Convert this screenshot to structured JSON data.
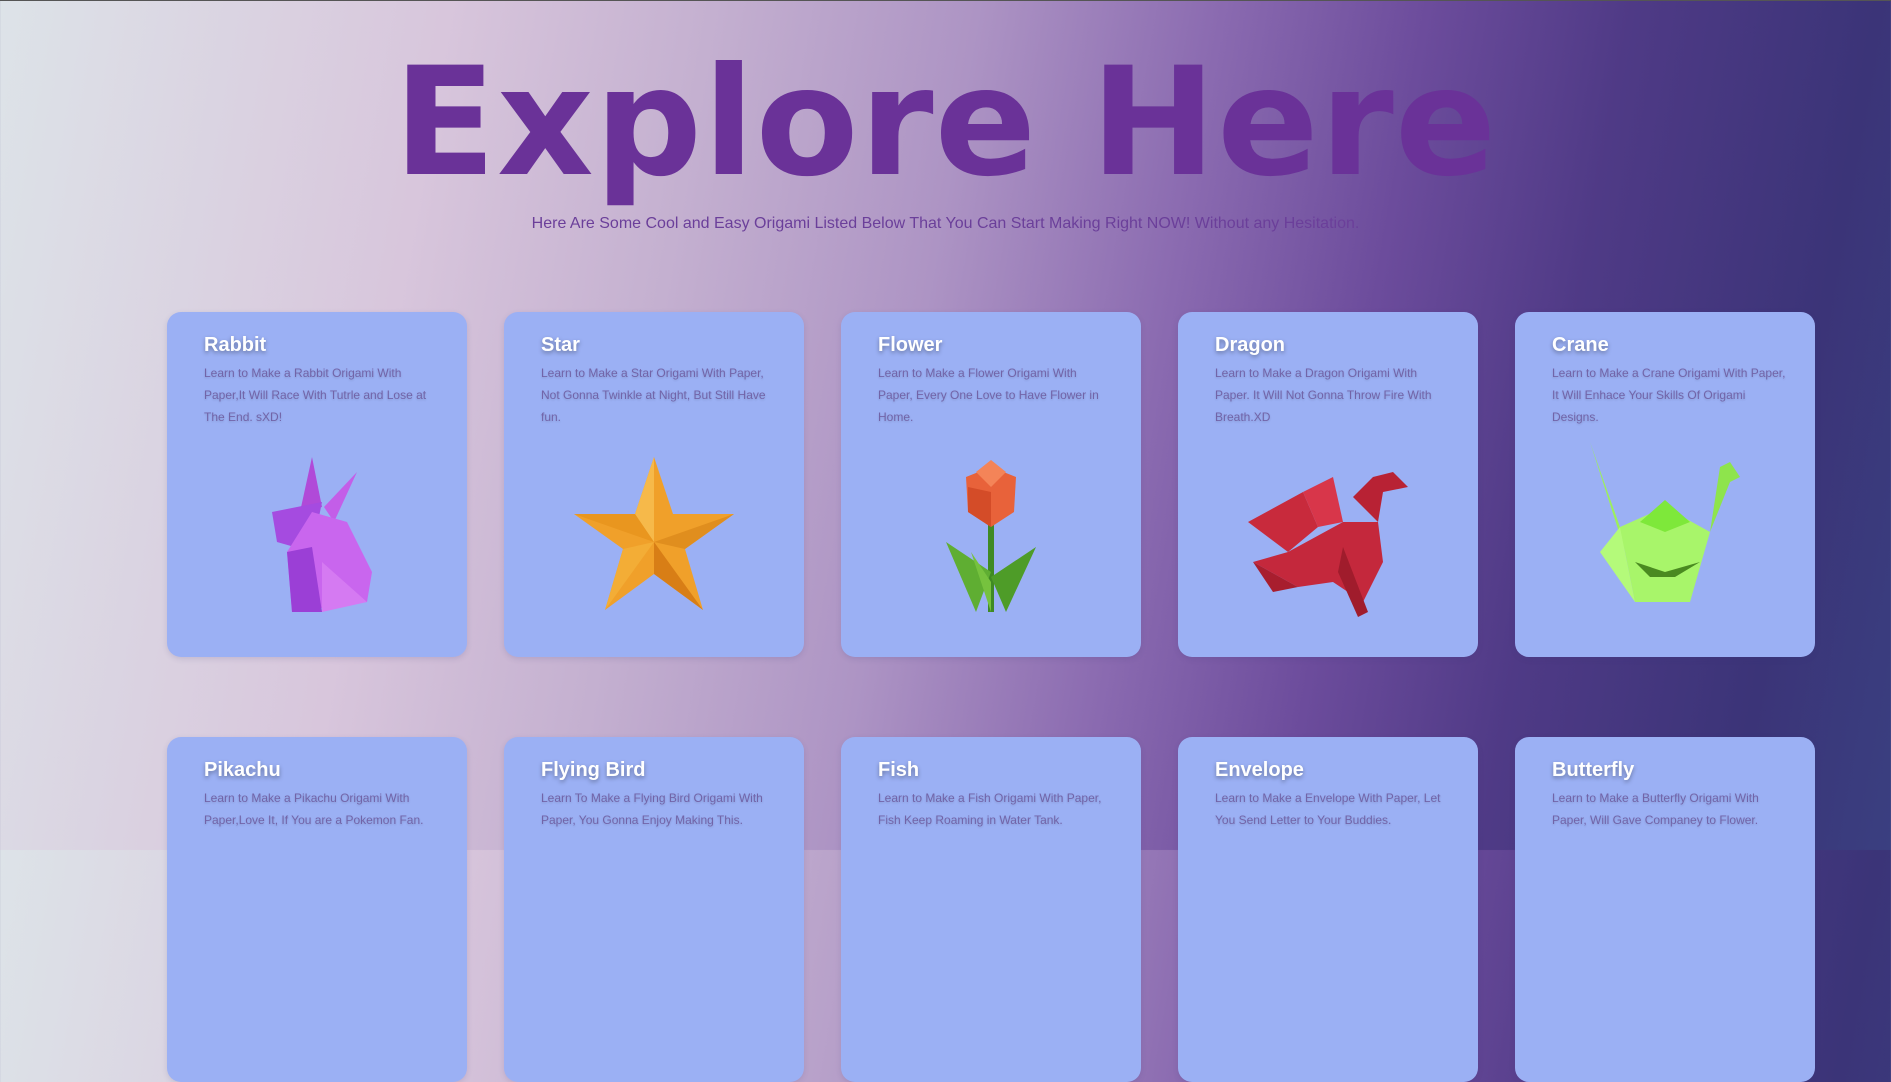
{
  "hero": {
    "title": "Explore Here",
    "subtitle": "Here Are Some Cool and Easy Origami Listed Below That You Can Start Making Right NOW! Without any Hesitation."
  },
  "cards": [
    {
      "title": "Rabbit",
      "desc": "Learn to Make a Rabbit Origami With Paper,It Will Race With Tutrle and Lose at The End. sXD!",
      "image": "rabbit-origami"
    },
    {
      "title": "Star",
      "desc": "Learn to Make a Star Origami With Paper, Not Gonna Twinkle at Night, But Still Have fun.",
      "image": "star-origami"
    },
    {
      "title": "Flower",
      "desc": "Learn to Make a Flower Origami With Paper, Every One Love to Have Flower in Home.",
      "image": "flower-origami"
    },
    {
      "title": "Dragon",
      "desc": "Learn to Make a Dragon Origami With Paper. It Will Not Gonna Throw Fire With Breath.XD",
      "image": "dragon-origami"
    },
    {
      "title": "Crane",
      "desc": "Learn to Make a Crane Origami With Paper, It Will Enhace Your Skills Of Origami Designs.",
      "image": "crane-origami"
    },
    {
      "title": "Pikachu",
      "desc": "Learn to Make a Pikachu Origami With Paper,Love It, If You are a Pokemon Fan.",
      "image": "pikachu-origami"
    },
    {
      "title": "Flying Bird",
      "desc": "Learn To Make a Flying Bird Origami With Paper, You Gonna Enjoy Making This.",
      "image": "flying-bird-origami"
    },
    {
      "title": "Fish",
      "desc": "Learn to Make a Fish Origami With Paper, Fish Keep Roaming in Water Tank.",
      "image": "fish-origami"
    },
    {
      "title": "Envelope",
      "desc": "Learn to Make a Envelope With Paper, Let You Send Letter to Your Buddies.",
      "image": "envelope-origami"
    },
    {
      "title": "Butterfly",
      "desc": "Learn to Make a Butterfly Origami With Paper, Will Gave Companey to Flower.",
      "image": "butterfly-origami"
    }
  ],
  "colors": {
    "title": "#6a3298",
    "card": "#9bb0f4"
  }
}
